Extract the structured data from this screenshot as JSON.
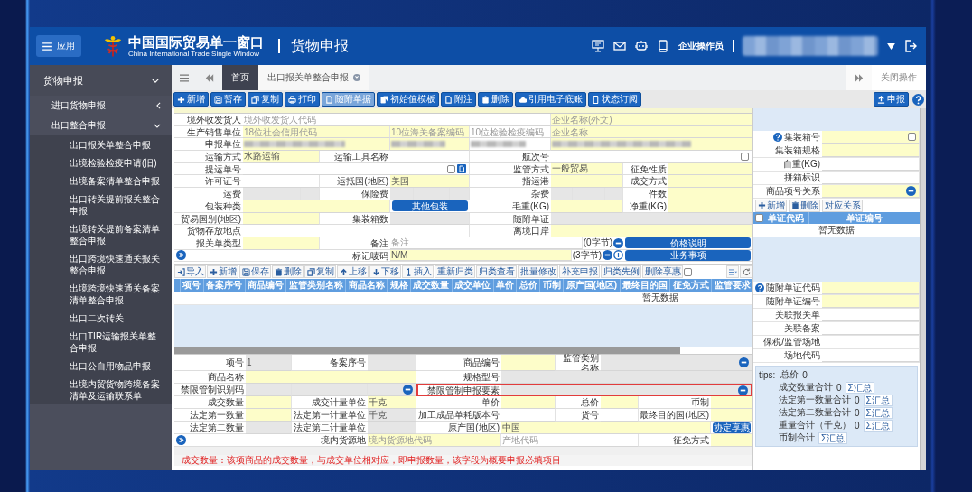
{
  "header": {
    "app_button": "应用",
    "title": "中国国际贸易单一窗口",
    "subtitle": "China International Trade Single Window",
    "module": "货物申报",
    "user_role": "企业操作员"
  },
  "sidebar": {
    "title": "货物申报",
    "groups": [
      {
        "label": "进口货物申报",
        "expanded": false
      },
      {
        "label": "出口整合申报",
        "expanded": true,
        "children": [
          {
            "label": "出口报关单整合申报"
          },
          {
            "label": "出境检验检疫申请(旧)"
          },
          {
            "label": "出境备案清单整合申报"
          },
          {
            "label": "出口转关提前报关整合申报"
          },
          {
            "label": "出境转关提前备案清单整合申报"
          },
          {
            "label": "出口跨境快速通关报关整合申报"
          },
          {
            "label": "出境跨境快速通关备案清单整合申报"
          },
          {
            "label": "出口二次转关"
          },
          {
            "label": "出口TIR运输报关单整合申报"
          },
          {
            "label": "出口公自用物品申报"
          },
          {
            "label": "出境内贸货物跨境备案清单及运输联系单"
          }
        ]
      }
    ]
  },
  "tabs": [
    {
      "label": "首页",
      "selected": false,
      "closable": false
    },
    {
      "label": "出口报关单整合申报",
      "selected": true,
      "closable": true
    }
  ],
  "close_action": "关闭操作",
  "toolbar": {
    "buttons": [
      {
        "label": "新增",
        "kind": "add",
        "disabled": false
      },
      {
        "label": "暂存",
        "kind": "save",
        "disabled": false
      },
      {
        "label": "复制",
        "kind": "copy",
        "disabled": false
      },
      {
        "label": "打印",
        "kind": "print",
        "disabled": false
      },
      {
        "label": "随附单据",
        "kind": "attach",
        "disabled": true
      },
      {
        "label": "初始值模板",
        "kind": "template",
        "disabled": false
      },
      {
        "label": "附注",
        "kind": "note",
        "disabled": false
      },
      {
        "label": "删除",
        "kind": "delete",
        "disabled": false
      },
      {
        "label": "引用电子底账",
        "kind": "reference",
        "disabled": false
      },
      {
        "label": "状态订阅",
        "kind": "subscribe",
        "disabled": false
      }
    ],
    "submit": "申报"
  },
  "form": {
    "rows": [
      {
        "fields": [
          {
            "label": "境外收发货人",
            "inputs": [
              {
                "kind": "text",
                "placeholder": "境外收发货人代码",
                "required": false,
                "disabled": false
              },
              {
                "kind": "text",
                "placeholder": "企业名称(外文)",
                "required": true,
                "disabled": false
              }
            ]
          }
        ]
      },
      {
        "fields": [
          {
            "label": "生产销售单位",
            "inputs": [
              {
                "kind": "text",
                "placeholder": "18位社会信用代码",
                "required": true,
                "disabled": false
              },
              {
                "kind": "text",
                "placeholder": "10位海关备案编码",
                "required": true,
                "disabled": false
              },
              {
                "kind": "text",
                "placeholder": "10位检验检疫编码",
                "required": false,
                "disabled": false
              },
              {
                "kind": "text",
                "placeholder": "企业名称",
                "required": true,
                "disabled": false
              }
            ]
          }
        ]
      },
      {
        "fields": [
          {
            "label": "申报单位",
            "inputs": [
              {
                "kind": "redacted",
                "required": true,
                "disabled": false
              },
              {
                "kind": "redacted",
                "required": true,
                "disabled": false
              },
              {
                "kind": "redacted",
                "required": false,
                "disabled": false
              },
              {
                "kind": "redacted",
                "required": true,
                "disabled": false
              }
            ]
          }
        ]
      },
      {
        "fields": [
          {
            "label": "运输方式",
            "inputs": [
              {
                "kind": "text",
                "value": "水路运输",
                "required": true,
                "disabled": false
              }
            ]
          },
          {
            "label": "运输工具名称",
            "inputs": [
              {
                "kind": "text",
                "required": false,
                "disabled": false
              }
            ]
          },
          {
            "label": "航次号",
            "inputs": [
              {
                "kind": "check",
                "required": false,
                "disabled": false,
                "checked": false
              }
            ]
          }
        ]
      },
      {
        "fields": [
          {
            "label": "提运单号",
            "inputs": [
              {
                "kind": "check_doc",
                "required": false,
                "disabled": false,
                "checked": false
              }
            ]
          },
          {
            "label": "监管方式",
            "inputs": [
              {
                "kind": "text",
                "value": "一般贸易",
                "required": true,
                "disabled": false
              }
            ]
          },
          {
            "label": "征免性质",
            "inputs": [
              {
                "kind": "text",
                "required": true,
                "disabled": false
              }
            ]
          }
        ]
      },
      {
        "fields": [
          {
            "label": "许可证号",
            "inputs": [
              {
                "kind": "text",
                "required": false,
                "disabled": false
              }
            ]
          },
          {
            "label": "运抵国(地区)",
            "inputs": [
              {
                "kind": "text",
                "value": "美国",
                "required": true,
                "disabled": false
              }
            ]
          },
          {
            "label": "指运港",
            "inputs": [
              {
                "kind": "text",
                "required": true,
                "disabled": false
              }
            ]
          },
          {
            "label": "成交方式",
            "inputs": [
              {
                "kind": "text",
                "required": true,
                "disabled": false
              }
            ]
          }
        ]
      },
      {
        "fields": [
          {
            "label": "运费",
            "inputs": [
              {
                "kind": "split",
                "required": false,
                "disabled": true
              }
            ]
          },
          {
            "label": "保险费",
            "inputs": [
              {
                "kind": "split",
                "required": false,
                "disabled": true
              }
            ]
          },
          {
            "label": "杂费",
            "inputs": [
              {
                "kind": "split",
                "required": false,
                "disabled": true
              }
            ]
          },
          {
            "label": "件数",
            "inputs": [
              {
                "kind": "text",
                "required": true,
                "disabled": false
              }
            ]
          }
        ]
      },
      {
        "fields": [
          {
            "label": "包装种类",
            "inputs": [
              {
                "kind": "text",
                "required": true,
                "disabled": false
              },
              {
                "kind": "button",
                "text": "其他包装"
              }
            ]
          },
          {
            "label": "毛重(KG)",
            "inputs": [
              {
                "kind": "text",
                "required": true,
                "disabled": false
              }
            ]
          },
          {
            "label": "净重(KG)",
            "inputs": [
              {
                "kind": "text",
                "required": true,
                "disabled": false
              }
            ]
          }
        ]
      },
      {
        "fields": [
          {
            "label": "贸易国别(地区)",
            "inputs": [
              {
                "kind": "text",
                "required": true,
                "disabled": false
              }
            ]
          },
          {
            "label": "集装箱数",
            "inputs": [
              {
                "kind": "text",
                "required": false,
                "disabled": true
              }
            ]
          },
          {
            "label": "随附单证",
            "inputs": [
              {
                "kind": "text",
                "required": false,
                "disabled": true
              }
            ]
          }
        ]
      },
      {
        "fields": [
          {
            "label": "货物存放地点",
            "inputs": [
              {
                "kind": "text",
                "required": false,
                "disabled": false
              }
            ]
          },
          {
            "label": "离境口岸",
            "inputs": [
              {
                "kind": "text",
                "required": true,
                "disabled": false
              }
            ]
          }
        ]
      },
      {
        "fields": [
          {
            "label": "报关单类型",
            "inputs": [
              {
                "kind": "text",
                "required": true,
                "disabled": false
              }
            ]
          },
          {
            "label": "备注",
            "inputs": [
              {
                "kind": "note",
                "placeholder": "备注",
                "counter": "(0字节)",
                "required": false,
                "disabled": false
              },
              {
                "kind": "button",
                "text": "价格说明"
              }
            ]
          }
        ]
      },
      {
        "fields": [
          {
            "inputs": [
              {
                "kind": "expander"
              }
            ]
          },
          {
            "label": "标记唛码",
            "inputs": [
              {
                "kind": "note_ext",
                "value": "N/M",
                "counter": "(3字节)",
                "required": true,
                "disabled": false
              },
              {
                "kind": "button",
                "text": "业务事项"
              }
            ]
          }
        ]
      }
    ]
  },
  "goods": {
    "toolbar": [
      {
        "label": "导入",
        "kind": "import"
      },
      {
        "label": "新增",
        "kind": "add"
      },
      {
        "label": "保存",
        "kind": "save"
      },
      {
        "label": "删除",
        "kind": "delete"
      },
      {
        "label": "复制",
        "kind": "copy"
      },
      {
        "label": "上移",
        "kind": "move_up"
      },
      {
        "label": "下移",
        "kind": "move_down"
      },
      {
        "label": "插入",
        "kind": "insert"
      },
      {
        "label": "重新归类",
        "kind": "plain"
      },
      {
        "label": "归类查看",
        "kind": "plain"
      },
      {
        "label": "批量修改",
        "kind": "plain"
      },
      {
        "label": "补充申报",
        "kind": "plain"
      },
      {
        "label": "归类先例",
        "kind": "plain"
      },
      {
        "label": "删除享惠",
        "kind": "plain"
      }
    ],
    "option_checked": false,
    "columns": [
      "项号",
      "备案序号",
      "商品编号",
      "监管类别名称",
      "商品名称",
      "规格",
      "成交数量",
      "成交单位",
      "单价",
      "总价",
      "币制",
      "原产国(地区)",
      "最终目的国",
      "征免方式",
      "监管要求"
    ],
    "empty": "暂无数据"
  },
  "detail": {
    "rows": [
      {
        "fields": [
          {
            "label": "项号",
            "highlighted": false,
            "inputs": [
              {
                "kind": "text",
                "value": "1",
                "required": false,
                "disabled": true
              }
            ]
          },
          {
            "label": "备案序号",
            "highlighted": false,
            "inputs": [
              {
                "kind": "text",
                "required": false,
                "disabled": true
              }
            ]
          },
          {
            "label": "商品编号",
            "highlighted": false,
            "inputs": [
              {
                "kind": "text",
                "required": true,
                "disabled": false
              }
            ]
          },
          {
            "label": "监管类别名称",
            "highlighted": false,
            "inputs": [
              {
                "kind": "lookup",
                "required": false,
                "disabled": true
              }
            ]
          }
        ]
      },
      {
        "fields": [
          {
            "label": "商品名称",
            "highlighted": false,
            "inputs": [
              {
                "kind": "text",
                "required": true,
                "disabled": false
              }
            ]
          },
          {
            "label": "规格型号",
            "highlighted": false,
            "inputs": [
              {
                "kind": "text",
                "required": false,
                "disabled": true
              }
            ]
          }
        ]
      },
      {
        "fields": [
          {
            "label": "禁限管制识别码",
            "highlighted": false,
            "inputs": [
              {
                "kind": "text",
                "required": false,
                "disabled": true
              },
              {
                "kind": "text",
                "required": false,
                "disabled": true
              },
              {
                "kind": "lookup",
                "required": false,
                "disabled": true
              }
            ]
          },
          {
            "label": "禁限管制申报要素",
            "highlighted": true,
            "inputs": [
              {
                "kind": "lookup",
                "required": false,
                "disabled": true
              }
            ]
          }
        ]
      },
      {
        "fields": [
          {
            "label": "成交数量",
            "highlighted": false,
            "inputs": [
              {
                "kind": "text",
                "required": true,
                "disabled": false
              }
            ]
          },
          {
            "label": "成交计量单位",
            "highlighted": false,
            "inputs": [
              {
                "kind": "text",
                "value": "千克",
                "required": true,
                "disabled": false
              }
            ]
          },
          {
            "label": "单价",
            "highlighted": false,
            "inputs": [
              {
                "kind": "text",
                "required": true,
                "disabled": false
              }
            ]
          },
          {
            "label": "总价",
            "highlighted": false,
            "inputs": [
              {
                "kind": "text",
                "required": true,
                "disabled": false
              }
            ]
          },
          {
            "label": "币制",
            "highlighted": false,
            "inputs": [
              {
                "kind": "text",
                "required": true,
                "disabled": false
              }
            ]
          }
        ]
      },
      {
        "fields": [
          {
            "label": "法定第一数量",
            "highlighted": false,
            "inputs": [
              {
                "kind": "text",
                "required": true,
                "disabled": false
              }
            ]
          },
          {
            "label": "法定第一计量单位",
            "highlighted": false,
            "inputs": [
              {
                "kind": "text",
                "value": "千克",
                "required": false,
                "disabled": true
              }
            ]
          },
          {
            "label": "加工成品单耗版本号",
            "highlighted": false,
            "inputs": [
              {
                "kind": "text",
                "required": false,
                "disabled": false
              }
            ]
          },
          {
            "label": "货号",
            "highlighted": false,
            "inputs": [
              {
                "kind": "text",
                "required": false,
                "disabled": false
              }
            ]
          },
          {
            "label": "最终目的国(地区)",
            "highlighted": false,
            "inputs": [
              {
                "kind": "text",
                "required": true,
                "disabled": false
              }
            ]
          }
        ]
      },
      {
        "fields": [
          {
            "label": "法定第二数量",
            "highlighted": false,
            "inputs": [
              {
                "kind": "text",
                "required": false,
                "disabled": true
              }
            ]
          },
          {
            "label": "法定第二计量单位",
            "highlighted": false,
            "inputs": [
              {
                "kind": "text",
                "required": false,
                "disabled": true
              }
            ]
          },
          {
            "label": "原产国(地区)",
            "highlighted": false,
            "inputs": [
              {
                "kind": "text",
                "value": "中国",
                "required": true,
                "disabled": false
              },
              {
                "kind": "button",
                "text": "协定享惠"
              }
            ]
          }
        ]
      },
      {
        "fields": [
          {
            "inputs": [
              {
                "kind": "expander"
              }
            ]
          },
          {
            "label": "境内货源地",
            "highlighted": false,
            "inputs": [
              {
                "kind": "text",
                "placeholder": "境内货源地代码",
                "required": true,
                "disabled": false
              },
              {
                "kind": "text",
                "placeholder": "产地代码",
                "required": false,
                "disabled": false
              }
            ]
          },
          {
            "label": "征免方式",
            "highlighted": false,
            "inputs": [
              {
                "kind": "text",
                "required": true,
                "disabled": false
              }
            ]
          }
        ]
      }
    ]
  },
  "side": {
    "rows": [
      {
        "label": "集装箱号",
        "help": true,
        "kind": "check",
        "required": true,
        "disabled": false,
        "checked": false
      },
      {
        "label": "集装箱规格",
        "help": false,
        "kind": "text",
        "required": true,
        "disabled": false
      },
      {
        "label": "自重(KG)",
        "help": false,
        "kind": "text",
        "required": false,
        "disabled": false
      },
      {
        "label": "拼箱标识",
        "help": false,
        "kind": "text",
        "required": false,
        "disabled": false
      },
      {
        "label": "商品项号关系",
        "help": false,
        "kind": "lookup",
        "required": true,
        "disabled": false
      }
    ],
    "doc_buttons": [
      {
        "label": "新增",
        "kind": "add"
      },
      {
        "label": "删除",
        "kind": "delete"
      },
      {
        "label": "对应关系",
        "kind": "plain"
      }
    ],
    "doc_select_all": false,
    "doc_columns": [
      "单证代码",
      "单证编号"
    ],
    "doc_empty": "暂无数据",
    "rows2": [
      {
        "label": "随附单证代码",
        "help": true,
        "kind": "text",
        "required": true,
        "disabled": false
      },
      {
        "label": "随附单证编号",
        "help": false,
        "kind": "text",
        "required": true,
        "disabled": false
      },
      {
        "label": "关联报关单",
        "help": false,
        "kind": "text",
        "required": false,
        "disabled": false
      },
      {
        "label": "关联备案",
        "help": false,
        "kind": "text",
        "required": false,
        "disabled": false
      },
      {
        "label": "保税/监管场地",
        "help": false,
        "kind": "text",
        "required": false,
        "disabled": false
      },
      {
        "label": "场地代码",
        "help": false,
        "kind": "text",
        "required": false,
        "disabled": false
      }
    ],
    "tips": {
      "label": "tips:",
      "total_label": "总价",
      "total_value": "0",
      "rows": [
        {
          "label": "成交数量合计",
          "value": "0",
          "button": "Σ汇总"
        },
        {
          "label": "法定第一数量合计",
          "value": "0",
          "button": "Σ汇总"
        },
        {
          "label": "法定第二数量合计",
          "value": "0",
          "button": "Σ汇总"
        },
        {
          "label": "重量合计（千克）",
          "value": "0",
          "button": "Σ汇总"
        },
        {
          "label": "币制合计",
          "button": "Σ汇总"
        }
      ]
    }
  },
  "hint": "成交数量：该项商品的成交数量，与成交单位相对应，即申报数量，该字段为概要申报必填项目"
}
